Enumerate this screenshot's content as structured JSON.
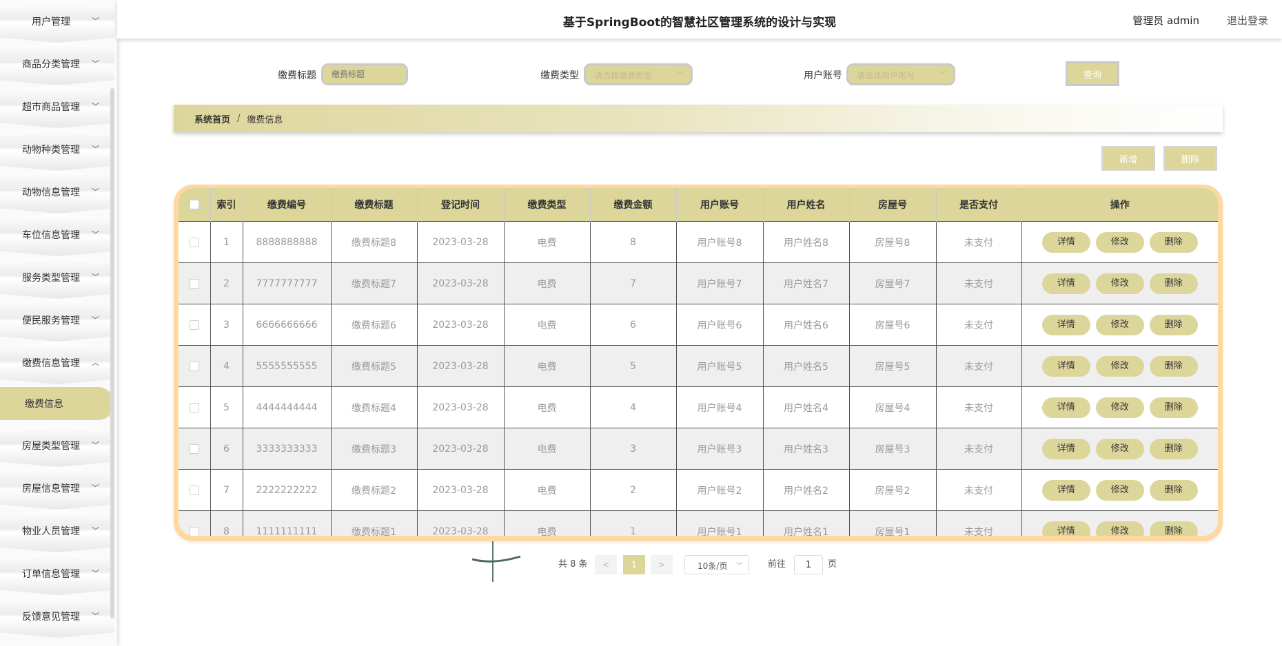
{
  "header": {
    "title": "基于SpringBoot的智慧社区管理系统的设计与实现",
    "user_label": "管理员 admin",
    "logout_label": "退出登录"
  },
  "sidebar": {
    "items": [
      {
        "label": "用户管理",
        "chevron": "chevron-down-icon"
      },
      {
        "label": "商品分类管理",
        "chevron": "chevron-down-icon"
      },
      {
        "label": "超市商品管理",
        "chevron": "chevron-down-icon"
      },
      {
        "label": "动物种类管理",
        "chevron": "chevron-down-icon"
      },
      {
        "label": "动物信息管理",
        "chevron": "chevron-down-icon"
      },
      {
        "label": "车位信息管理",
        "chevron": "chevron-down-icon"
      },
      {
        "label": "服务类型管理",
        "chevron": "chevron-down-icon"
      },
      {
        "label": "便民服务管理",
        "chevron": "chevron-down-icon"
      },
      {
        "label": "缴费信息管理",
        "chevron": "chevron-up-icon",
        "expanded": true
      },
      {
        "label": "房屋类型管理",
        "chevron": "chevron-down-icon"
      },
      {
        "label": "房屋信息管理",
        "chevron": "chevron-down-icon"
      },
      {
        "label": "物业人员管理",
        "chevron": "chevron-down-icon"
      },
      {
        "label": "订单信息管理",
        "chevron": "chevron-down-icon"
      },
      {
        "label": "反馈意见管理",
        "chevron": "chevron-down-icon"
      }
    ],
    "active_subitem": "缴费信息"
  },
  "search": {
    "title_label": "缴费标题",
    "title_placeholder": "缴费标题",
    "type_label": "缴费类型",
    "type_placeholder": "请选择缴费类型",
    "account_label": "用户账号",
    "account_placeholder": "请选择用户账号",
    "query_label": "查询"
  },
  "breadcrumb": {
    "home": "系统首页",
    "separator": "/",
    "current": "缴费信息"
  },
  "actions": {
    "add_label": "新增",
    "delete_label": "删除"
  },
  "table": {
    "columns": [
      "索引",
      "缴费编号",
      "缴费标题",
      "登记时间",
      "缴费类型",
      "缴费金额",
      "用户账号",
      "用户姓名",
      "房屋号",
      "是否支付",
      "操作"
    ],
    "row_actions": {
      "detail": "详情",
      "edit": "修改",
      "delete": "删除"
    },
    "rows": [
      [
        "1",
        "8888888888",
        "缴费标题8",
        "2023-03-28",
        "电费",
        "8",
        "用户账号8",
        "用户姓名8",
        "房屋号8",
        "未支付"
      ],
      [
        "2",
        "7777777777",
        "缴费标题7",
        "2023-03-28",
        "电费",
        "7",
        "用户账号7",
        "用户姓名7",
        "房屋号7",
        "未支付"
      ],
      [
        "3",
        "6666666666",
        "缴费标题6",
        "2023-03-28",
        "电费",
        "6",
        "用户账号6",
        "用户姓名6",
        "房屋号6",
        "未支付"
      ],
      [
        "4",
        "5555555555",
        "缴费标题5",
        "2023-03-28",
        "电费",
        "5",
        "用户账号5",
        "用户姓名5",
        "房屋号5",
        "未支付"
      ],
      [
        "5",
        "4444444444",
        "缴费标题4",
        "2023-03-28",
        "电费",
        "4",
        "用户账号4",
        "用户姓名4",
        "房屋号4",
        "未支付"
      ],
      [
        "6",
        "3333333333",
        "缴费标题3",
        "2023-03-28",
        "电费",
        "3",
        "用户账号3",
        "用户姓名3",
        "房屋号3",
        "未支付"
      ],
      [
        "7",
        "2222222222",
        "缴费标题2",
        "2023-03-28",
        "电费",
        "2",
        "用户账号2",
        "用户姓名2",
        "房屋号2",
        "未支付"
      ],
      [
        "8",
        "1111111111",
        "缴费标题1",
        "2023-03-28",
        "电费",
        "1",
        "用户账号1",
        "用户姓名1",
        "房屋号1",
        "未支付"
      ]
    ]
  },
  "pagination": {
    "total_text": "共 8 条",
    "prev": "<",
    "current_page": "1",
    "next": ">",
    "page_size": "10条/页",
    "goto_prefix": "前往",
    "goto_value": "1",
    "goto_suffix": "页"
  },
  "colors": {
    "accent": "#ddd69b",
    "table_border": "#ffd8a0",
    "row_alt": "#efefef"
  }
}
